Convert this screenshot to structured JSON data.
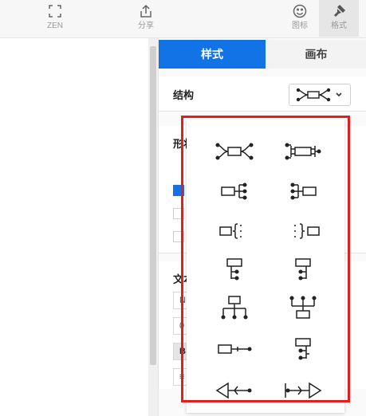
{
  "toolbar": {
    "zen_label": "ZEN",
    "share_label": "分享",
    "icon_label": "图标",
    "format_label": "格式"
  },
  "panel": {
    "tabs": [
      {
        "label": "样式",
        "active": true
      },
      {
        "label": "画布",
        "active": false
      }
    ],
    "structure_label": "结构",
    "shape_label": "形状",
    "text_label": "文本",
    "shape_options": [
      {
        "checked": true
      },
      {
        "checked": false
      },
      {
        "checked": false
      }
    ],
    "text_fields": [
      "N",
      "0",
      "B",
      "≡"
    ]
  },
  "structure_options": [
    "fishbone-both",
    "fishbone-both-alt",
    "right-branch",
    "left-branch",
    "right-brace",
    "left-brace",
    "down-tree-right",
    "down-tree-left",
    "org-chart-down",
    "org-chart-up",
    "timeline-right",
    "down-tree-both",
    "fishbone-left",
    "fishbone-right"
  ],
  "colors": {
    "accent": "#1273e6",
    "highlight": "#e02020"
  }
}
